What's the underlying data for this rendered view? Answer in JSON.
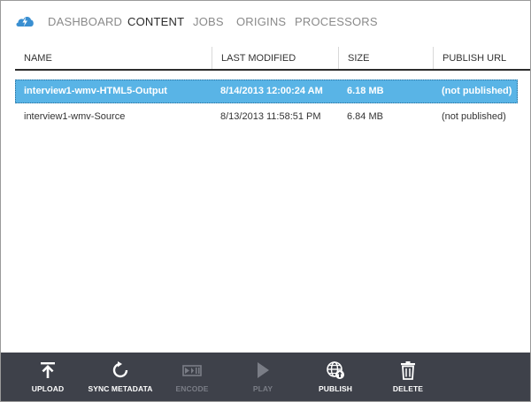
{
  "nav": {
    "tabs": [
      {
        "label": "DASHBOARD",
        "active": false
      },
      {
        "label": "CONTENT",
        "active": true
      },
      {
        "label": "JOBS",
        "active": false
      },
      {
        "label": "ORIGINS",
        "active": false
      },
      {
        "label": "PROCESSORS",
        "active": false
      }
    ]
  },
  "table": {
    "columns": [
      "NAME",
      "LAST MODIFIED",
      "SIZE",
      "PUBLISH URL"
    ],
    "rows": [
      {
        "name": "interview1-wmv-HTML5-Output",
        "modified": "8/14/2013 12:00:24 AM",
        "size": "6.18 MB",
        "url": "(not published)",
        "selected": true
      },
      {
        "name": "interview1-wmv-Source",
        "modified": "8/13/2013 11:58:51 PM",
        "size": "6.84 MB",
        "url": "(not published)",
        "selected": false
      }
    ]
  },
  "toolbar": {
    "buttons": [
      {
        "label": "UPLOAD",
        "icon": "upload-icon",
        "enabled": true
      },
      {
        "label": "SYNC METADATA",
        "icon": "refresh-icon",
        "enabled": true
      },
      {
        "label": "ENCODE",
        "icon": "encode-icon",
        "enabled": false
      },
      {
        "label": "PLAY",
        "icon": "play-icon",
        "enabled": false
      },
      {
        "label": "PUBLISH",
        "icon": "globe-upload-icon",
        "enabled": true
      },
      {
        "label": "DELETE",
        "icon": "trash-icon",
        "enabled": true
      }
    ]
  },
  "colors": {
    "accent": "#59b4e6",
    "toolbar": "#3e414a",
    "logo": "#3a8fd1"
  }
}
